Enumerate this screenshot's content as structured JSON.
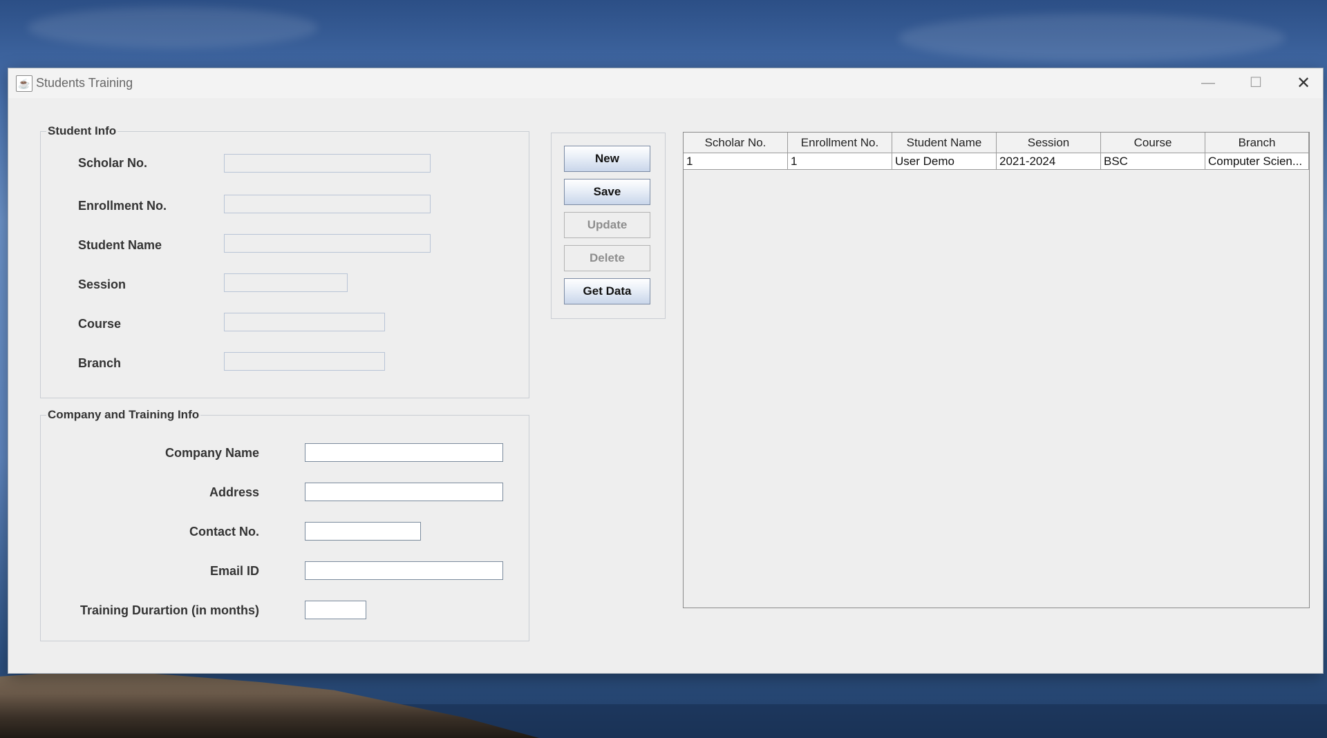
{
  "window": {
    "title": "Students Training",
    "controls": {
      "minimize": "—",
      "maximize": "☐",
      "close": "✕"
    }
  },
  "student_info": {
    "title": "Student Info",
    "labels": {
      "scholar_no": "Scholar No.",
      "enrollment_no": "Enrollment No.",
      "student_name": "Student Name",
      "session": "Session",
      "course": "Course",
      "branch": "Branch"
    },
    "values": {
      "scholar_no": "",
      "enrollment_no": "",
      "student_name": "",
      "session": "",
      "course": "",
      "branch": ""
    }
  },
  "company_info": {
    "title": "Company and Training Info",
    "labels": {
      "company_name": "Company Name",
      "address": "Address",
      "contact_no": "Contact No.",
      "email_id": "Email ID",
      "training_duration": "Training Durartion (in months)"
    },
    "values": {
      "company_name": "",
      "address": "",
      "contact_no": "",
      "email_id": "",
      "training_duration": ""
    }
  },
  "buttons": {
    "new": "New",
    "save": "Save",
    "update": "Update",
    "delete": "Delete",
    "get_data": "Get Data"
  },
  "table": {
    "headers": [
      "Scholar No.",
      "Enrollment No.",
      "Student Name",
      "Session",
      "Course",
      "Branch"
    ],
    "rows": [
      [
        "1",
        "1",
        "User Demo",
        "2021-2024",
        "BSC",
        "Computer Scien..."
      ]
    ]
  }
}
